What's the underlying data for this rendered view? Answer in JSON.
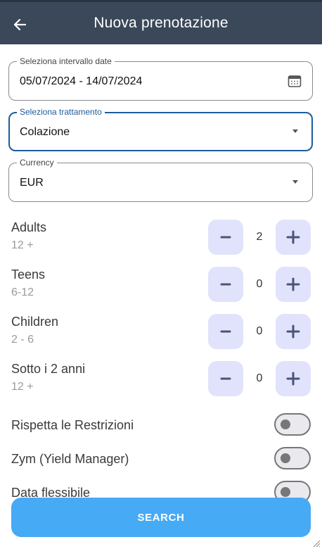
{
  "header": {
    "title": "Nuova prenotazione",
    "back_icon": "arrow-left-icon"
  },
  "form": {
    "date_range": {
      "label": "Seleziona intervallo date",
      "value": "05/07/2024 - 14/07/2024",
      "icon": "calendar-icon"
    },
    "treatment": {
      "label": "Seleziona trattamento",
      "value": "Colazione"
    },
    "currency": {
      "label": "Currency",
      "value": "EUR"
    }
  },
  "guests": [
    {
      "label": "Adults",
      "age": "12 +",
      "count": "2"
    },
    {
      "label": "Teens",
      "age": "6-12",
      "count": "0"
    },
    {
      "label": "Children",
      "age": "2 - 6",
      "count": "0"
    },
    {
      "label": "Sotto i 2 anni",
      "age": "12 +",
      "count": "0"
    }
  ],
  "stepper": {
    "minus": "–",
    "plus": "+"
  },
  "toggles": [
    {
      "label": "Rispetta le Restrizioni",
      "on": false
    },
    {
      "label": "Zym (Yield Manager)",
      "on": false
    },
    {
      "label": "Data flessibile",
      "on": false
    }
  ],
  "actions": {
    "search_label": "SEARCH"
  },
  "colors": {
    "header_bg": "#3a4859",
    "focus": "#1d5c9a",
    "stepper_bg": "#e0e3fb",
    "stepper_fg": "#4a5478",
    "primary_button": "#47aaf5"
  }
}
